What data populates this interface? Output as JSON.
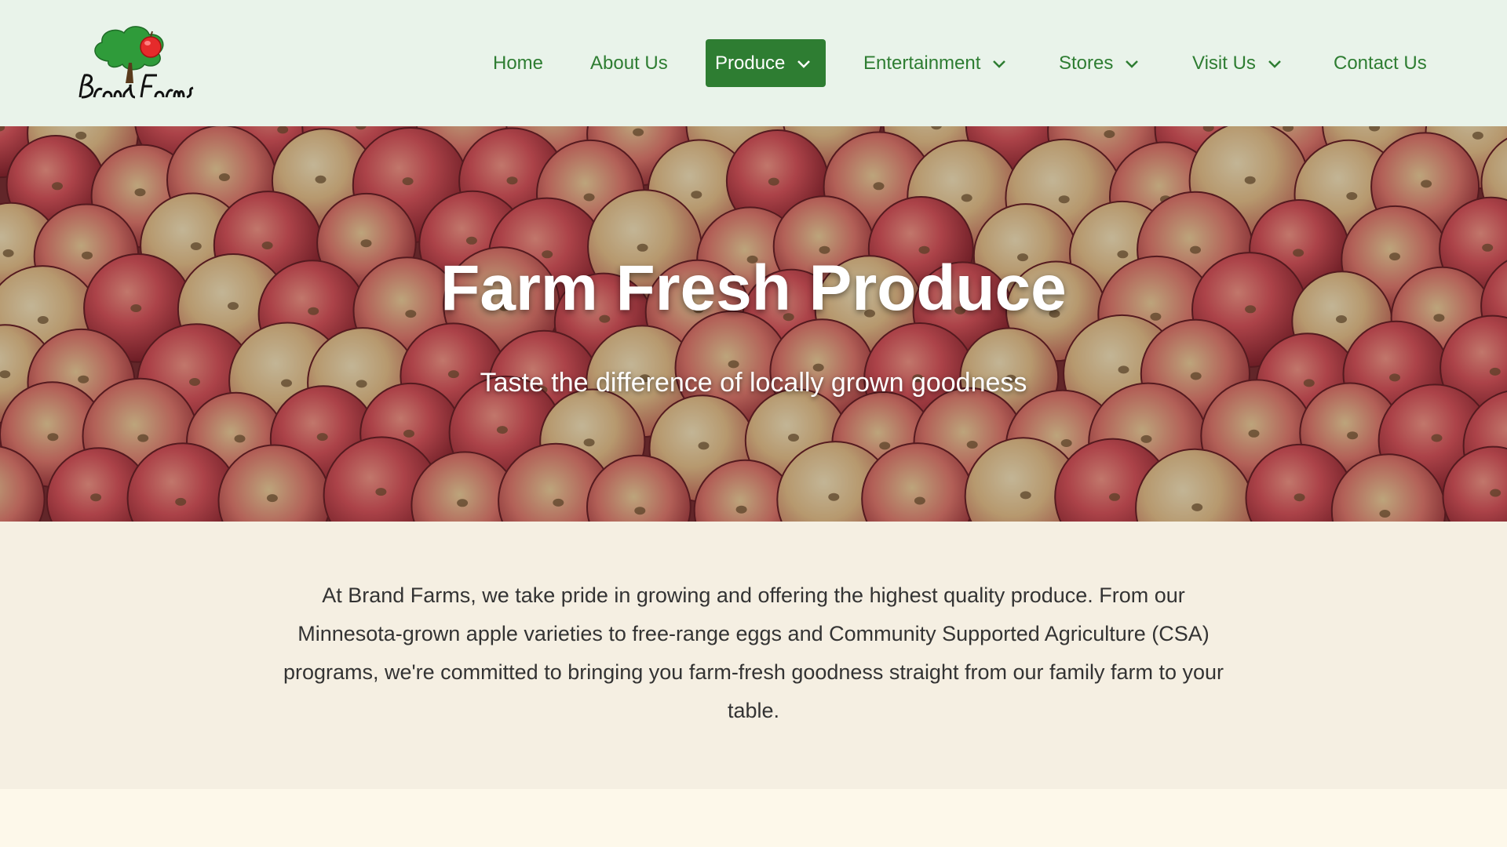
{
  "brand": {
    "logo_text": "Brand Farms",
    "primary_color": "#2e7d32",
    "header_bg": "#e9f3ea"
  },
  "nav": {
    "items": [
      {
        "label": "Home",
        "has_dropdown": false,
        "active": false
      },
      {
        "label": "About Us",
        "has_dropdown": false,
        "active": false
      },
      {
        "label": "Produce",
        "has_dropdown": true,
        "active": true
      },
      {
        "label": "Entertainment",
        "has_dropdown": true,
        "active": false
      },
      {
        "label": "Stores",
        "has_dropdown": true,
        "active": false
      },
      {
        "label": "Visit Us",
        "has_dropdown": true,
        "active": false
      },
      {
        "label": "Contact Us",
        "has_dropdown": false,
        "active": false
      }
    ]
  },
  "hero": {
    "title": "Farm Fresh Produce",
    "subtitle": "Taste the difference of locally grown goodness"
  },
  "intro": {
    "text": "At Brand Farms, we take pride in growing and offering the highest quality produce. From our Minnesota-grown apple varieties to free-range eggs and Community Supported Agriculture (CSA) programs, we're committed to bringing you farm-fresh goodness straight from our family farm to your table."
  }
}
